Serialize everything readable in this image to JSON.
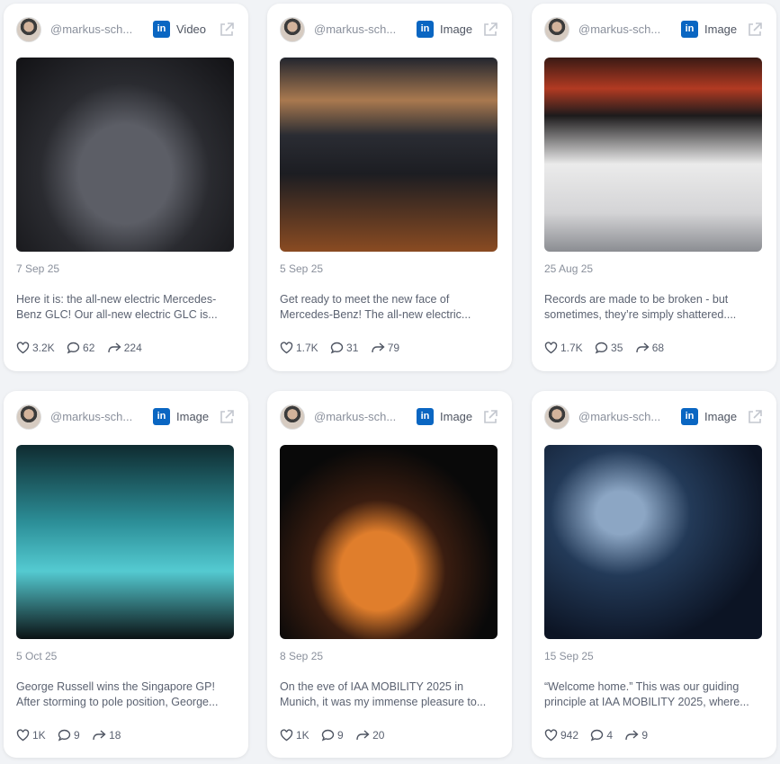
{
  "posts": [
    {
      "handle": "@markus-sch...",
      "type": "Video",
      "date": "7 Sep 25",
      "text": "Here it is: the all-new electric Mercedes-Benz GLC!   Our all-new electric GLC is...",
      "likes": "3.2K",
      "comments": "62",
      "shares": "224"
    },
    {
      "handle": "@markus-sch...",
      "type": "Image",
      "date": "5 Sep 25",
      "text": "Get ready to meet the new face of Mercedes-Benz!   The all-new electric...",
      "likes": "1.7K",
      "comments": "31",
      "shares": "79"
    },
    {
      "handle": "@markus-sch...",
      "type": "Image",
      "date": "25 Aug 25",
      "text": "Records are made to be broken - but sometimes, they’re simply shattered....",
      "likes": "1.7K",
      "comments": "35",
      "shares": "68"
    },
    {
      "handle": "@markus-sch...",
      "type": "Image",
      "date": "5 Oct 25",
      "text": "George Russell wins the Singapore GP! After storming to pole position, George...",
      "likes": "1K",
      "comments": "9",
      "shares": "18"
    },
    {
      "handle": "@markus-sch...",
      "type": "Image",
      "date": "8 Sep 25",
      "text": "On the eve of IAA MOBILITY 2025 in Munich, it was my immense pleasure to...",
      "likes": "1K",
      "comments": "9",
      "shares": "20"
    },
    {
      "handle": "@markus-sch...",
      "type": "Image",
      "date": "15 Sep 25",
      "text": "“Welcome home.” This was our guiding principle at IAA MOBILITY 2025, where...",
      "likes": "942",
      "comments": "4",
      "shares": "9"
    }
  ],
  "icons": {
    "network": "linkedin-icon",
    "open": "external-link-icon",
    "like": "heart-icon",
    "comment": "comment-icon",
    "share": "share-icon"
  },
  "colors": {
    "linkedin": "#0a66c2",
    "background": "#f1f3f6",
    "card": "#ffffff"
  }
}
